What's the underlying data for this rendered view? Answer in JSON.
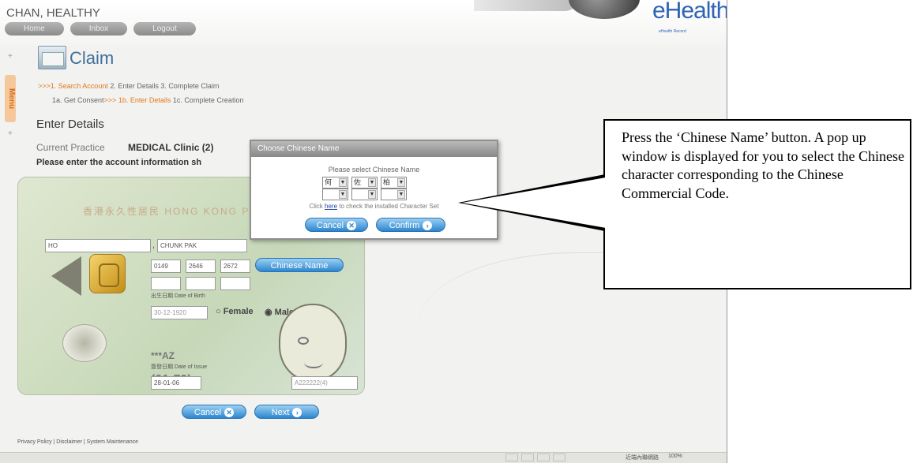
{
  "header": {
    "user_name": "CHAN, HEALTHY",
    "nav": [
      "Home",
      "Inbox",
      "Logout"
    ],
    "logo_text": "eHealth",
    "logo_subtext": "eHealth Record"
  },
  "sidebar": {
    "menu_label": "Menu"
  },
  "page": {
    "title": "Claim",
    "steps_row1": {
      "arrows": ">>>",
      "step1": "1. Search Account",
      "step2": "2. Enter Details",
      "step3": "3. Complete Claim"
    },
    "steps_row2": {
      "step1a": "1a. Get Consent",
      "arrows": ">>>",
      "step1b": "1b. Enter Details",
      "step1c": "1c. Complete Creation"
    },
    "section_title": "Enter Details",
    "practice_label": "Current Practice",
    "practice_value": "MEDICAL Clinic (2)",
    "instruction": "Please enter the account information sh"
  },
  "id_card": {
    "heading": "香港永久性居民 HONG KONG PERMANENT",
    "surname": "HO",
    "given_name": "CHUNK PAK",
    "codes": [
      "0149",
      "2646",
      "2672"
    ],
    "chinese_name_button": "Chinese Name",
    "dob_label": "出生日期 Date of Birth",
    "dob_value": "30-12-1920",
    "gender_female": "Female",
    "gender_male": "Male",
    "symbols": "***AZ",
    "issue_label": "簽發日期 Date of Issue",
    "issue_code": "(01-79)",
    "issue_date": "28-01-06",
    "hkid": "A222222(4)"
  },
  "actions": {
    "cancel": "Cancel",
    "next": "Next"
  },
  "dialog": {
    "title": "Choose Chinese Name",
    "prompt": "Please select Chinese Name",
    "chars": [
      "何",
      "佐",
      "柏"
    ],
    "note_prefix": "Click",
    "note_link": "here",
    "note_suffix": "to check the installed Character Set",
    "cancel": "Cancel",
    "confirm": "Confirm"
  },
  "footer": {
    "links": "Privacy Policy | Disclaimer | System Maintenance"
  },
  "statusbar": {
    "zone": "近端內聯網路",
    "zoom": "100%"
  },
  "callout": {
    "text": "Press the ‘Chinese Name’ button. A pop up window is displayed for you to select the Chinese character corresponding to the Chinese Commercial Code."
  }
}
